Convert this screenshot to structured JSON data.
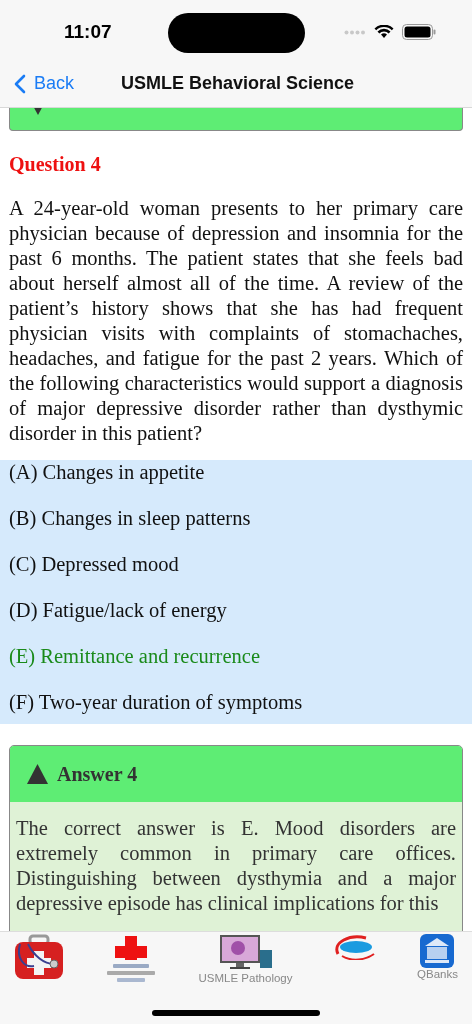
{
  "status_bar": {
    "time": "11:07"
  },
  "nav": {
    "back": "Back",
    "title": "USMLE Behavioral Science"
  },
  "previous_answer": {
    "expanded": false
  },
  "question": {
    "title": "Question 4",
    "text": "A 24-year-old woman presents to her primary care physician because of depression and insomnia for the past 6 months. The patient states that she feels bad about herself almost all of the time. A review of the patient’s history shows that she has had frequent physician visits with complaints of stomachaches, headaches, and fatigue for the past 2 years. Which of the following characteristics would support a diagnosis of major depressive disorder rather than dysthymic disorder in this patient?",
    "options": [
      {
        "text": "(A) Changes in appetite",
        "correct": false
      },
      {
        "text": "(B) Changes in sleep patterns",
        "correct": false
      },
      {
        "text": "(C) Depressed mood",
        "correct": false
      },
      {
        "text": "(D) Fatigue/lack of energy",
        "correct": false
      },
      {
        "text": "(E) Remittance and recurrence",
        "correct": true
      },
      {
        "text": "(F) Two-year duration of symptoms",
        "correct": false
      }
    ]
  },
  "answer": {
    "title": "Answer 4",
    "expanded": true,
    "text": "The correct answer is E. Mood disorders are extremely common in primary care offices. Distinguishing between dysthymia and a major depressive episode has clinical implications for this"
  },
  "tab_bar": [
    {
      "kind": "medkit"
    },
    {
      "kind": "cross"
    },
    {
      "kind": "monitor",
      "label": "USMLE Pathology"
    },
    {
      "kind": "mcq"
    },
    {
      "kind": "bank",
      "label": "QBanks"
    }
  ]
}
